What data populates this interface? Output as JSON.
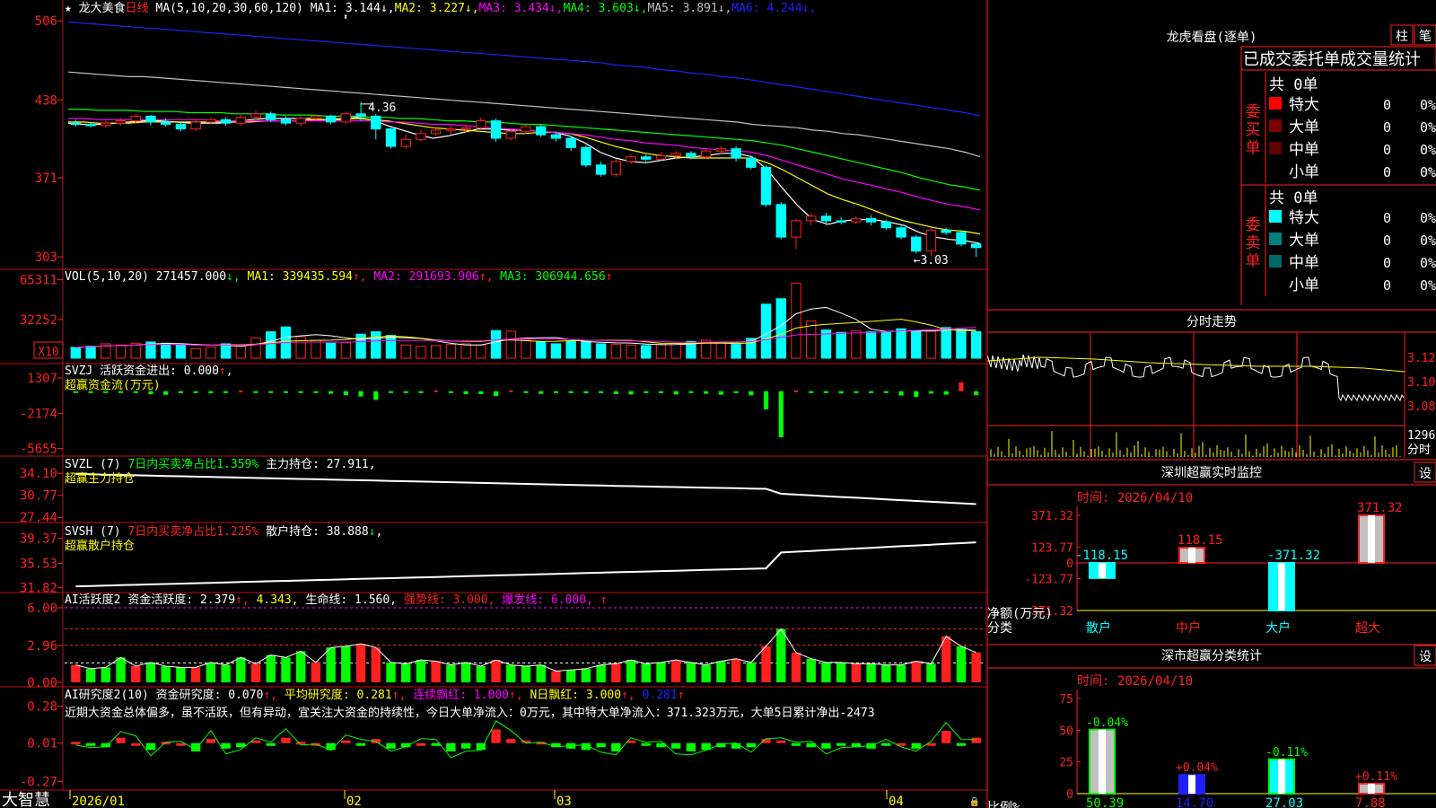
{
  "colors": {
    "up": "#ff2020",
    "down": "#00ffff",
    "green": "#00ff00",
    "yellow": "#ffff00",
    "magenta": "#ff00ff",
    "white": "#ffffff",
    "grid": "#c01010",
    "blue": "#2020ff",
    "teal": "#008080",
    "darkred": "#800000"
  },
  "footer": {
    "brand": "大智慧",
    "dates": [
      "2026/01",
      "02",
      "03",
      "04"
    ]
  },
  "panels": {
    "main": {
      "star": "★",
      "name": "龙大美食",
      "period": "日线",
      "ma_label": "MA(5,10,20,30,60,120)",
      "mas": [
        {
          "label": "MA1:",
          "value": "3.144",
          "arrow": "↓",
          "color": "#ffffff"
        },
        {
          "label": "MA2:",
          "value": "3.227",
          "arrow": "↓",
          "color": "#ffff00"
        },
        {
          "label": "MA3:",
          "value": "3.434",
          "arrow": "↓",
          "color": "#ff00ff"
        },
        {
          "label": "MA4:",
          "value": "3.603",
          "arrow": "↓",
          "color": "#00ff00"
        },
        {
          "label": "MA5:",
          "value": "3.891",
          "arrow": "↓",
          "color": "#c0c0c0"
        },
        {
          "label": "MA6:",
          "value": "4.244",
          "arrow": "↓",
          "color": "#2020ff"
        }
      ],
      "axis": [
        "506",
        "438",
        "371",
        "303"
      ],
      "hi_label": "4.36",
      "lo_label": "←3.03"
    },
    "vol": {
      "name": "VOL(5,10,20)",
      "value": "271457.000",
      "arrow": "↓",
      "ma1": "MA1: 339435.594",
      "ma1a": "↑",
      "ma2": "MA2: 291693.906",
      "ma2a": "↑",
      "ma3": "MA3: 306944.656",
      "ma3a": "↑",
      "axis": [
        "65311",
        "32252"
      ],
      "unit": "X10"
    },
    "svzj": {
      "name": "SVZJ",
      "label": "活跃资金进出: 0.000",
      "arrow": "↑",
      "comma": ",",
      "sub": "超赢资金流(万元)",
      "axis": [
        "1307",
        "-2174",
        "-5655"
      ]
    },
    "svzl": {
      "name": "SVZL (7)",
      "t1": "7日内买卖净占比1.359%",
      "t2": "主力持仓: 27.911,",
      "sub": "超赢主力持仓",
      "axis": [
        "34.10",
        "30.77",
        "27.44"
      ]
    },
    "svsh": {
      "name": "SVSH (7)",
      "t1": "7日内买卖净占比1.225%",
      "t2": "散户持仓: 38.888",
      "arrow": "↓",
      "comma": ",",
      "sub": "超赢散户持仓",
      "axis": [
        "39.37",
        "35.53",
        "31.82"
      ]
    },
    "ai1": {
      "name": "AI活跃度2",
      "t1": "资金活跃度: 2.379",
      "a1": "↑",
      "t2": "4.343",
      "t3": "生命线: 1.560,",
      "t4": "强势线: 3.000,",
      "t5": "爆发线: 6.000,",
      "a2": "↑",
      "axis": [
        "6.00",
        "2.96",
        "0.00"
      ]
    },
    "ai2": {
      "name": "AI研究度2(10)",
      "t1": "资金研究度: 0.070",
      "a1": "↑",
      "t2": "平均研究度: 0.281",
      "a2": "↑",
      "t3": "连续飘红: 1.000",
      "a3": "↑",
      "t4": "N日飘红: 3.000",
      "a4": "↑",
      "t5": "0.281",
      "a5": "↑",
      "note": "近期大资金总体偏多，虽不活跃，但有异动，宜关注大资金的持续性，今日大单净流入：0万元，其中特大单净流入：371.323万元，大单5日累计净出-2473",
      "axis": [
        "0.28",
        "0.01",
        "-0.27"
      ]
    }
  },
  "side": {
    "top": {
      "title": "龙虎看盘(逐单)",
      "btn1": "柱",
      "btn2": "笔",
      "subtitle": "已成交委托单成交量统计",
      "buy": {
        "label": "委买单",
        "total": "共 0单",
        "rows": [
          {
            "name": "特大",
            "v": "0",
            "p": "0%",
            "c": "#ff0000"
          },
          {
            "name": "大单",
            "v": "0",
            "p": "0%",
            "c": "#800000"
          },
          {
            "name": "中单",
            "v": "0",
            "p": "0%",
            "c": "#600000"
          },
          {
            "name": "小单",
            "v": "0",
            "p": "0%",
            "c": ""
          }
        ]
      },
      "sell": {
        "label": "委卖单",
        "total": "共 0单",
        "rows": [
          {
            "name": "特大",
            "v": "0",
            "p": "0%",
            "c": "#00ffff"
          },
          {
            "name": "大单",
            "v": "0",
            "p": "0%",
            "c": "#008080"
          },
          {
            "name": "中单",
            "v": "0",
            "p": "0%",
            "c": "#006868"
          },
          {
            "name": "小单",
            "v": "0",
            "p": "0%",
            "c": ""
          }
        ]
      }
    },
    "intraday": {
      "title": "分时走势",
      "axis": [
        "3.120",
        "3.100",
        "3.080"
      ],
      "vol": "12960",
      "unit": "分时"
    },
    "monitor": {
      "title": "深圳超赢实时监控",
      "btn": "设",
      "time": "时间: 2026/04/10",
      "axis": [
        "371.32",
        "123.77",
        "0",
        "-123.77",
        "-371.32"
      ],
      "ylabel": "净额(万元)",
      "xlabel": "分类",
      "chart_data": {
        "type": "bar",
        "categories": [
          "散户",
          "中户",
          "大户",
          "超大"
        ],
        "values": [
          -118.15,
          118.15,
          -371.32,
          371.32
        ],
        "labels": [
          "-118.15",
          "118.15",
          "-371.32",
          "371.32"
        ],
        "ylim": [
          -371.32,
          371.32
        ]
      }
    },
    "stats": {
      "title": "深市超赢分类统计",
      "btn": "设",
      "time": "时间: 2026/04/10",
      "axis": [
        "75",
        "50",
        "25",
        "0"
      ],
      "ylabel": "比例%",
      "xlabel": "分类",
      "chart_data": {
        "type": "bar",
        "categories": [
          "散户",
          "中户",
          "大户",
          "超大"
        ],
        "values": [
          50.39,
          14.7,
          27.03,
          7.88
        ],
        "labels": [
          "50.39",
          "14.70",
          "27.03",
          "7.88"
        ],
        "changes": [
          "-0.04%",
          "+0.04%",
          "-0.11%",
          "+0.11%"
        ],
        "ylim": [
          0,
          75
        ]
      }
    }
  },
  "chart_data": {
    "type": "bar",
    "candles": [
      [
        4.18,
        4.17,
        4.21,
        4.15
      ],
      [
        4.17,
        4.16,
        4.19,
        4.14
      ],
      [
        4.16,
        4.18,
        4.2,
        4.14
      ],
      [
        4.18,
        4.2,
        4.22,
        4.16
      ],
      [
        4.2,
        4.24,
        4.26,
        4.18
      ],
      [
        4.24,
        4.19,
        4.25,
        4.16
      ],
      [
        4.19,
        4.17,
        4.22,
        4.15
      ],
      [
        4.17,
        4.13,
        4.19,
        4.11
      ],
      [
        4.13,
        4.19,
        4.21,
        4.11
      ],
      [
        4.19,
        4.21,
        4.23,
        4.17
      ],
      [
        4.21,
        4.18,
        4.23,
        4.16
      ],
      [
        4.18,
        4.23,
        4.25,
        4.16
      ],
      [
        4.23,
        4.26,
        4.29,
        4.21
      ],
      [
        4.26,
        4.21,
        4.28,
        4.19
      ],
      [
        4.21,
        4.18,
        4.24,
        4.16
      ],
      [
        4.18,
        4.22,
        4.24,
        4.15
      ],
      [
        4.22,
        4.24,
        4.26,
        4.2
      ],
      [
        4.24,
        4.19,
        4.25,
        4.17
      ],
      [
        4.19,
        4.26,
        4.28,
        4.17
      ],
      [
        4.26,
        4.24,
        4.36,
        4.2
      ],
      [
        4.24,
        4.13,
        4.26,
        4.04
      ],
      [
        4.13,
        3.98,
        4.15,
        3.96
      ],
      [
        3.98,
        4.04,
        4.08,
        3.96
      ],
      [
        4.04,
        4.09,
        4.12,
        4.02
      ],
      [
        4.09,
        4.12,
        4.14,
        4.07
      ],
      [
        4.12,
        4.13,
        4.16,
        4.08
      ],
      [
        4.13,
        4.14,
        4.17,
        4.1
      ],
      [
        4.14,
        4.2,
        4.23,
        4.12
      ],
      [
        4.2,
        4.05,
        4.22,
        4.02
      ],
      [
        4.05,
        4.11,
        4.13,
        4.03
      ],
      [
        4.11,
        4.15,
        4.17,
        4.09
      ],
      [
        4.15,
        4.08,
        4.17,
        4.06
      ],
      [
        4.08,
        4.05,
        4.11,
        4.02
      ],
      [
        4.05,
        3.97,
        4.07,
        3.94
      ],
      [
        3.97,
        3.82,
        3.99,
        3.8
      ],
      [
        3.82,
        3.74,
        3.85,
        3.72
      ],
      [
        3.74,
        3.85,
        3.87,
        3.72
      ],
      [
        3.85,
        3.89,
        3.91,
        3.83
      ],
      [
        3.89,
        3.87,
        3.91,
        3.84
      ],
      [
        3.87,
        3.9,
        3.93,
        3.85
      ],
      [
        3.9,
        3.92,
        3.94,
        3.87
      ],
      [
        3.92,
        3.89,
        3.94,
        3.87
      ],
      [
        3.89,
        3.94,
        3.96,
        3.87
      ],
      [
        3.94,
        3.96,
        3.98,
        3.91
      ],
      [
        3.96,
        3.88,
        3.98,
        3.85
      ],
      [
        3.88,
        3.8,
        3.9,
        3.78
      ],
      [
        3.8,
        3.48,
        3.82,
        3.46
      ],
      [
        3.48,
        3.2,
        3.5,
        3.18
      ],
      [
        3.2,
        3.34,
        3.36,
        3.1
      ],
      [
        3.34,
        3.38,
        3.4,
        3.3
      ],
      [
        3.38,
        3.34,
        3.41,
        3.3
      ],
      [
        3.34,
        3.33,
        3.37,
        3.31
      ],
      [
        3.33,
        3.36,
        3.38,
        3.31
      ],
      [
        3.36,
        3.33,
        3.39,
        3.3
      ],
      [
        3.33,
        3.28,
        3.35,
        3.26
      ],
      [
        3.28,
        3.2,
        3.3,
        3.18
      ],
      [
        3.2,
        3.08,
        3.22,
        3.06
      ],
      [
        3.08,
        3.26,
        3.28,
        3.04
      ],
      [
        3.26,
        3.24,
        3.28,
        3.22
      ],
      [
        3.24,
        3.14,
        3.26,
        3.12
      ],
      [
        3.14,
        3.11,
        3.16,
        3.03
      ]
    ],
    "ma": {
      "ma1": [
        4.18,
        4.17,
        4.17,
        4.18,
        4.19,
        4.2,
        4.2,
        4.19,
        4.18,
        4.18,
        4.18,
        4.19,
        4.21,
        4.22,
        4.22,
        4.22,
        4.22,
        4.21,
        4.22,
        4.23,
        4.21,
        4.16,
        4.12,
        4.08,
        4.05,
        4.07,
        4.1,
        4.13,
        4.13,
        4.12,
        4.12,
        4.11,
        4.1,
        4.07,
        4.01,
        3.93,
        3.88,
        3.85,
        3.84,
        3.86,
        3.88,
        3.89,
        3.9,
        3.92,
        3.92,
        3.89,
        3.78,
        3.62,
        3.47,
        3.35,
        3.31,
        3.34,
        3.35,
        3.35,
        3.33,
        3.3,
        3.24,
        3.2,
        3.18,
        3.17,
        3.144
      ],
      "ma2": [
        4.19,
        4.19,
        4.18,
        4.18,
        4.18,
        4.19,
        4.19,
        4.19,
        4.19,
        4.19,
        4.19,
        4.19,
        4.19,
        4.2,
        4.2,
        4.2,
        4.21,
        4.21,
        4.21,
        4.22,
        4.21,
        4.2,
        4.18,
        4.16,
        4.14,
        4.13,
        4.12,
        4.11,
        4.1,
        4.09,
        4.09,
        4.1,
        4.1,
        4.09,
        4.06,
        4.02,
        3.98,
        3.95,
        3.92,
        3.9,
        3.89,
        3.88,
        3.88,
        3.88,
        3.88,
        3.88,
        3.84,
        3.78,
        3.71,
        3.64,
        3.57,
        3.52,
        3.48,
        3.43,
        3.38,
        3.34,
        3.31,
        3.28,
        3.26,
        3.25,
        3.227
      ],
      "ma3": [
        4.22,
        4.22,
        4.21,
        4.21,
        4.21,
        4.21,
        4.21,
        4.21,
        4.21,
        4.21,
        4.2,
        4.2,
        4.2,
        4.2,
        4.2,
        4.2,
        4.2,
        4.2,
        4.2,
        4.2,
        4.2,
        4.19,
        4.19,
        4.18,
        4.17,
        4.17,
        4.16,
        4.15,
        4.14,
        4.13,
        4.12,
        4.11,
        4.1,
        4.09,
        4.08,
        4.06,
        4.04,
        4.03,
        4.01,
        4.0,
        3.99,
        3.97,
        3.96,
        3.95,
        3.94,
        3.93,
        3.9,
        3.86,
        3.82,
        3.78,
        3.74,
        3.7,
        3.67,
        3.64,
        3.61,
        3.58,
        3.54,
        3.51,
        3.48,
        3.46,
        3.434
      ],
      "ma4": [
        4.3,
        4.3,
        4.29,
        4.29,
        4.29,
        4.28,
        4.28,
        4.28,
        4.27,
        4.27,
        4.27,
        4.26,
        4.26,
        4.26,
        4.25,
        4.25,
        4.25,
        4.24,
        4.24,
        4.24,
        4.23,
        4.23,
        4.22,
        4.22,
        4.21,
        4.2,
        4.2,
        4.19,
        4.19,
        4.18,
        4.17,
        4.17,
        4.16,
        4.15,
        4.14,
        4.13,
        4.12,
        4.11,
        4.1,
        4.09,
        4.08,
        4.07,
        4.06,
        4.05,
        4.04,
        4.03,
        4.01,
        3.99,
        3.96,
        3.93,
        3.9,
        3.87,
        3.84,
        3.81,
        3.78,
        3.75,
        3.71,
        3.68,
        3.65,
        3.63,
        3.603
      ],
      "ma5": [
        4.62,
        4.61,
        4.6,
        4.59,
        4.58,
        4.58,
        4.57,
        4.56,
        4.55,
        4.54,
        4.53,
        4.52,
        4.51,
        4.5,
        4.49,
        4.48,
        4.47,
        4.46,
        4.45,
        4.44,
        4.43,
        4.42,
        4.41,
        4.4,
        4.39,
        4.38,
        4.37,
        4.36,
        4.35,
        4.34,
        4.33,
        4.32,
        4.31,
        4.3,
        4.29,
        4.28,
        4.27,
        4.26,
        4.25,
        4.24,
        4.23,
        4.22,
        4.21,
        4.2,
        4.19,
        4.17,
        4.16,
        4.15,
        4.14,
        4.12,
        4.11,
        4.09,
        4.08,
        4.06,
        4.04,
        4.02,
        4.0,
        3.98,
        3.96,
        3.93,
        3.891
      ],
      "ma6": [
        5.05,
        5.04,
        5.03,
        5.02,
        5.01,
        5.0,
        4.99,
        4.98,
        4.97,
        4.96,
        4.95,
        4.94,
        4.93,
        4.92,
        4.91,
        4.9,
        4.89,
        4.88,
        4.87,
        4.86,
        4.85,
        4.84,
        4.83,
        4.82,
        4.81,
        4.8,
        4.79,
        4.78,
        4.77,
        4.76,
        4.75,
        4.74,
        4.73,
        4.72,
        4.71,
        4.7,
        4.68,
        4.67,
        4.66,
        4.64,
        4.63,
        4.61,
        4.6,
        4.58,
        4.57,
        4.55,
        4.53,
        4.51,
        4.49,
        4.47,
        4.45,
        4.43,
        4.41,
        4.39,
        4.37,
        4.35,
        4.33,
        4.31,
        4.29,
        4.27,
        4.244
      ]
    },
    "vol": [
      180,
      200,
      240,
      220,
      250,
      270,
      250,
      220,
      160,
      190,
      240,
      200,
      340,
      440,
      520,
      360,
      300,
      250,
      260,
      400,
      440,
      380,
      220,
      200,
      210,
      230,
      240,
      220,
      460,
      450,
      300,
      270,
      240,
      290,
      280,
      240,
      230,
      220,
      210,
      230,
      250,
      280,
      300,
      260,
      230,
      330,
      900,
      990,
      1250,
      620,
      470,
      430,
      460,
      440,
      430,
      490,
      460,
      450,
      510,
      480,
      440
    ],
    "flow": [
      -80,
      -90,
      -120,
      -100,
      -140,
      -300,
      -350,
      -110,
      -180,
      -210,
      -150,
      0,
      -50,
      -30,
      -40,
      -70,
      -120,
      -250,
      -380,
      -520,
      -850,
      -150,
      -60,
      -90,
      0,
      -100,
      -300,
      -280,
      -490,
      0,
      -80,
      -260,
      -100,
      -120,
      -200,
      -40,
      -280,
      -320,
      -180,
      -200,
      -320,
      -150,
      -250,
      -350,
      -80,
      -400,
      -1800,
      -4550,
      0,
      -70,
      -110,
      -220,
      -170,
      -130,
      -50,
      -420,
      -560,
      -230,
      -340,
      880,
      -370,
      -80
    ]
  }
}
